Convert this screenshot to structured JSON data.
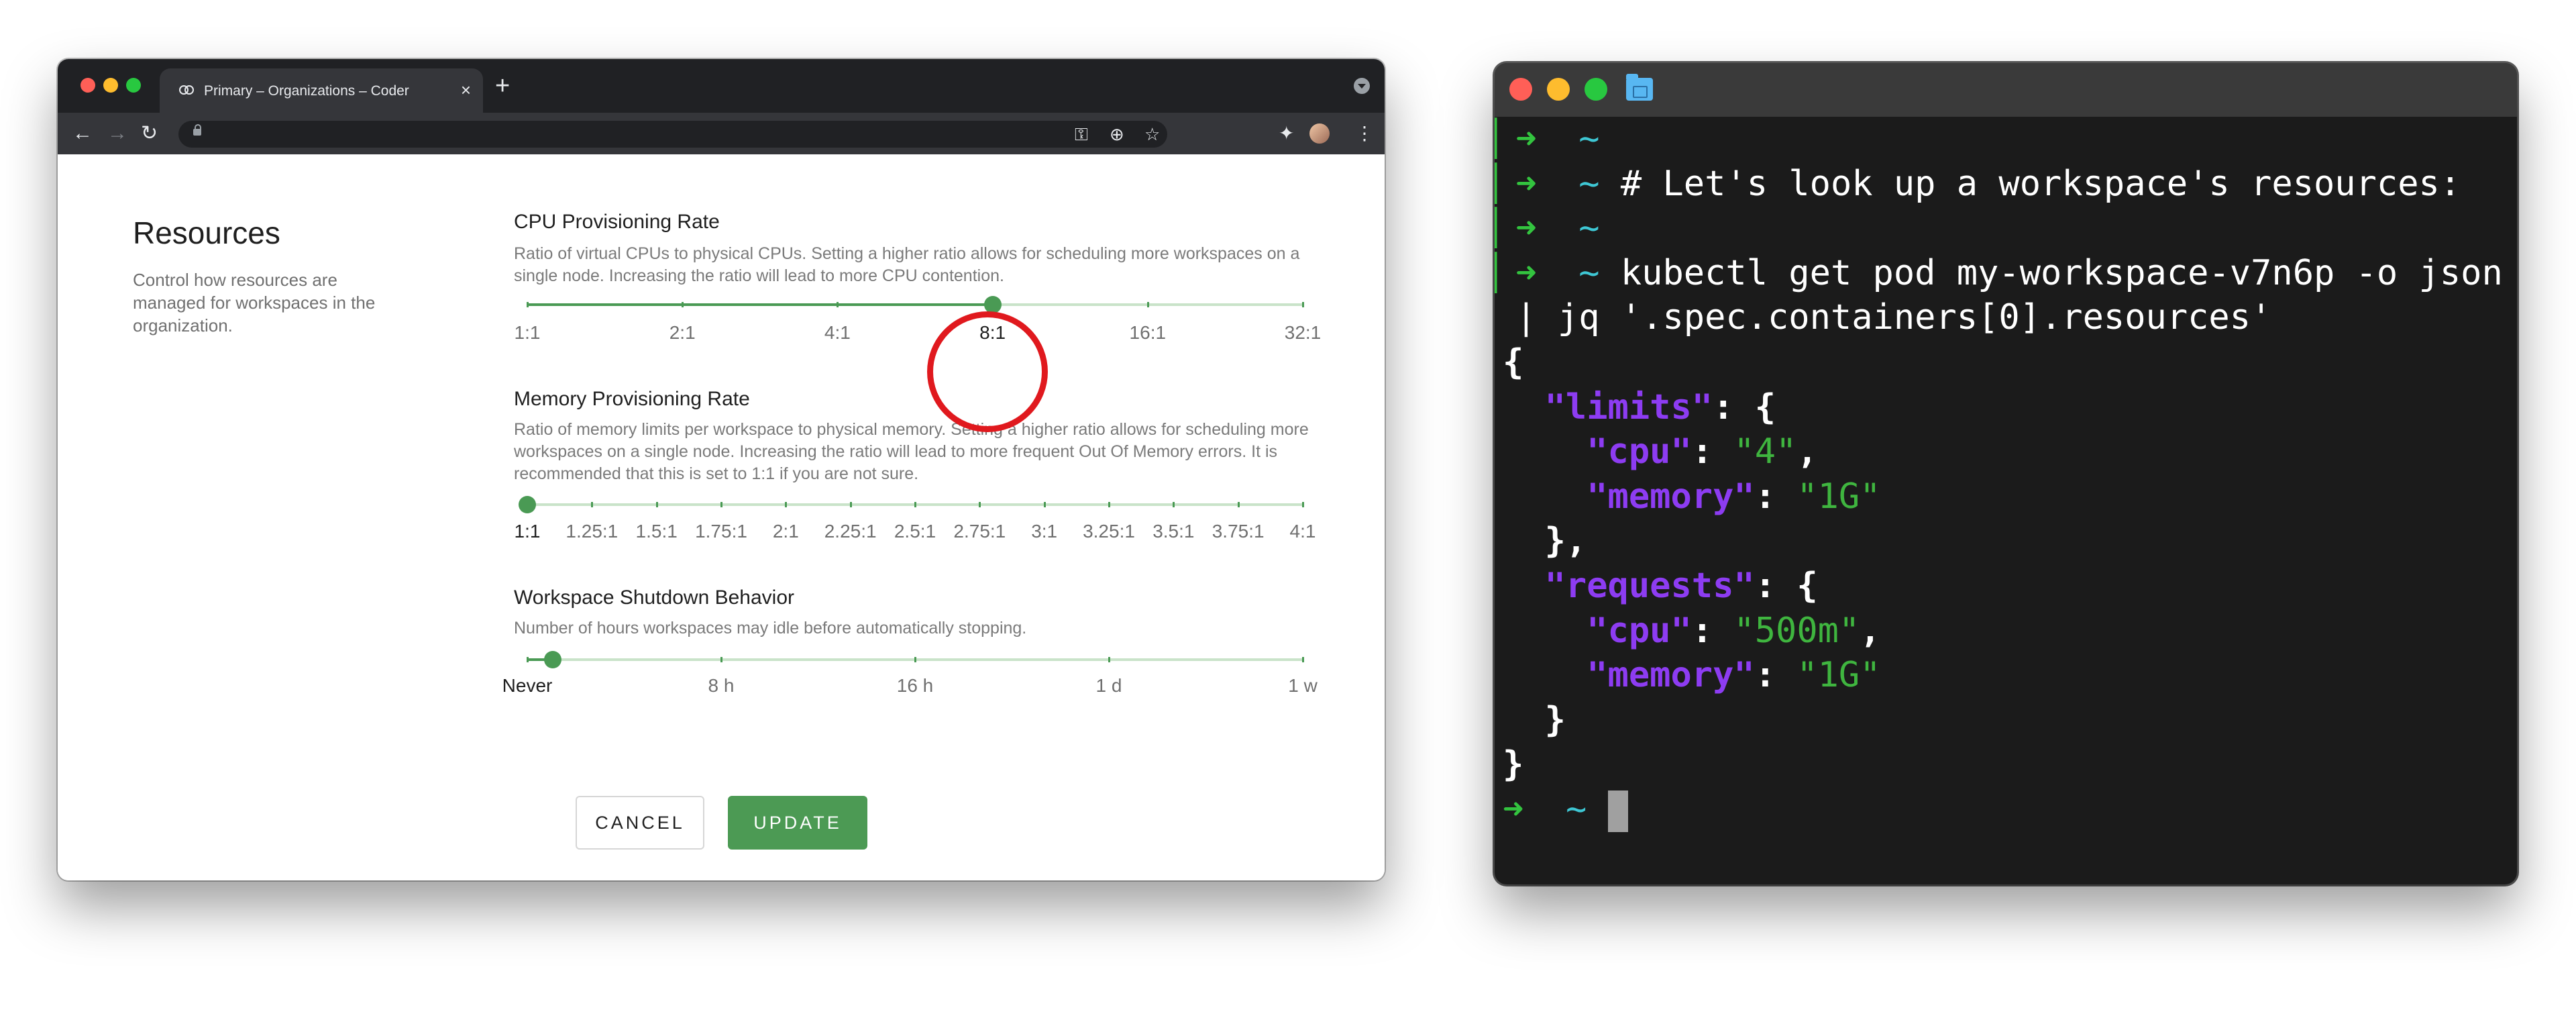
{
  "browser": {
    "tab": {
      "title": "Primary – Organizations – Coder"
    },
    "page": {
      "section_title": "Resources",
      "section_description": "Control how resources are managed for workspaces in the organization.",
      "cpu": {
        "title": "CPU Provisioning Rate",
        "description": "Ratio of virtual CPUs to physical CPUs. Setting a higher ratio allows for scheduling more workspaces on a single node. Increasing the ratio will lead to more CPU contention.",
        "marks": [
          "1:1",
          "2:1",
          "4:1",
          "8:1",
          "16:1",
          "32:1"
        ],
        "selected": "8:1",
        "selected_index": 3
      },
      "memory": {
        "title": "Memory Provisioning Rate",
        "description": "Ratio of memory limits per workspace to physical memory. Setting a higher ratio allows for scheduling more workspaces on a single node. Increasing the ratio will lead to more frequent Out Of Memory errors. It is recommended that this is set to 1:1 if you are not sure.",
        "marks": [
          "1:1",
          "1.25:1",
          "1.5:1",
          "1.75:1",
          "2:1",
          "2.25:1",
          "2.5:1",
          "2.75:1",
          "3:1",
          "3.25:1",
          "3.5:1",
          "3.75:1",
          "4:1"
        ],
        "selected": "1:1",
        "selected_index": 0
      },
      "shutdown": {
        "title": "Workspace Shutdown Behavior",
        "description": "Number of hours workspaces may idle before automatically stopping.",
        "marks": [
          "Never",
          "8 h",
          "16 h",
          "1 d",
          "1 w"
        ],
        "selected": "Never"
      },
      "buttons": {
        "cancel": "CANCEL",
        "update": "UPDATE"
      }
    }
  },
  "terminal": {
    "prompt_symbol": "➜",
    "prompt_dir": "~",
    "comment": "# Let's look up a workspace's resources:",
    "command": "kubectl get pod my-workspace-v7n6p -o json",
    "command_cont": " | jq '.spec.containers[0].resources'",
    "output": {
      "open": "{",
      "limits_key": "\"limits\"",
      "requests_key": "\"requests\"",
      "cpu_key": "\"cpu\"",
      "memory_key": "\"memory\"",
      "limits_cpu": "\"4\"",
      "limits_memory": "\"1G\"",
      "requests_cpu": "\"500m\"",
      "requests_memory": "\"1G\"",
      "close": "}"
    }
  },
  "colors": {
    "accent_green": "#4c9a54",
    "highlight_red": "#e0191e",
    "terminal_prompt": "#33c43f",
    "terminal_tilde": "#3ec7d4",
    "json_key": "#8d3cf2",
    "json_string": "#3fb53f"
  }
}
